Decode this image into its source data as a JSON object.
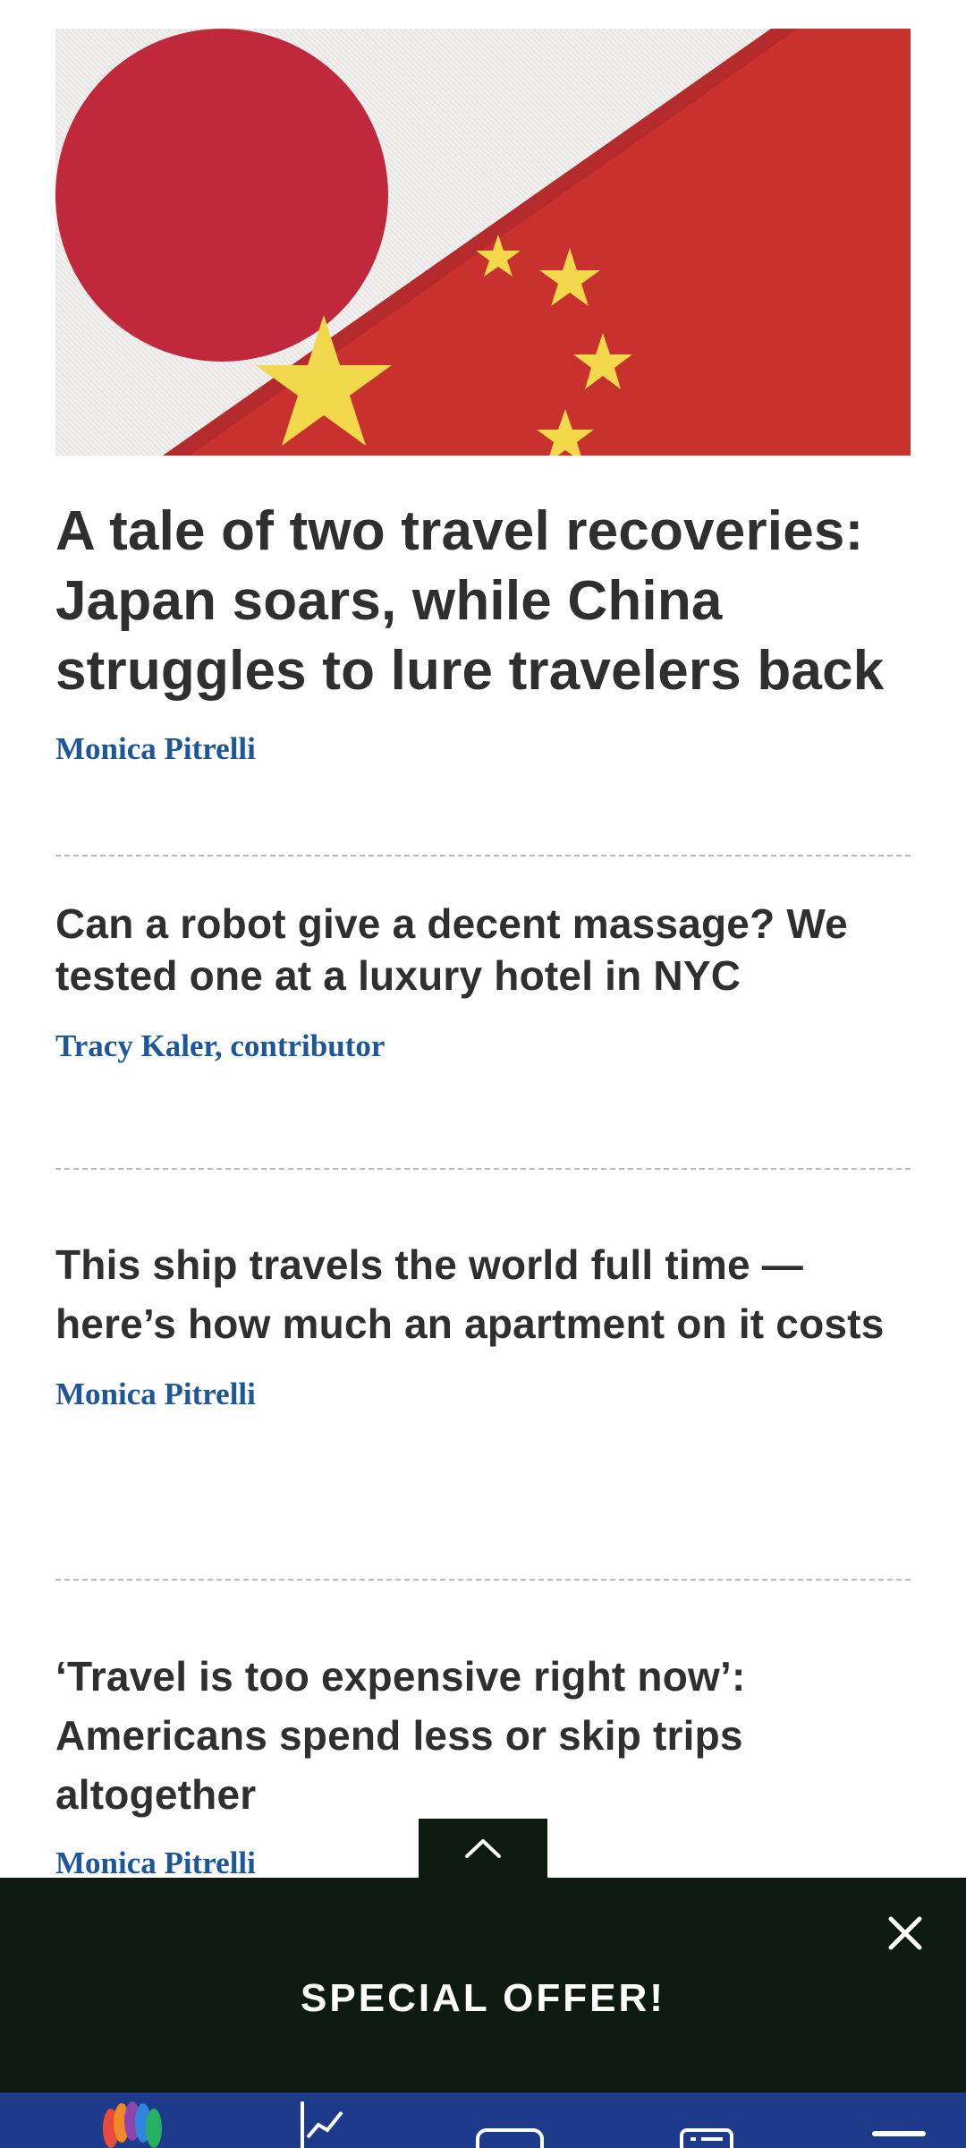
{
  "hero": {
    "image_alt": "Japanese and Chinese flags side by side"
  },
  "articles": [
    {
      "title": "A tale of two travel recoveries: Japan soars, while China struggles to lure travelers back",
      "author": "Monica Pitrelli"
    },
    {
      "title": "Can a robot give a decent massage? We tested one at a luxury hotel in NYC",
      "author": "Tracy Kaler, contributor"
    },
    {
      "title": "This ship travels the world full time — here’s how much an apartment on it costs",
      "author": "Monica Pitrelli"
    },
    {
      "title": "‘Travel is too expensive right now’: Americans spend less or skip trips altogether",
      "author": "Monica Pitrelli"
    }
  ],
  "banner": {
    "title": "SPECIAL OFFER!"
  },
  "colors": {
    "accent_link": "#1e5799",
    "banner_bg": "#0c1a12",
    "nav_bg": "#1e3a8a"
  },
  "icons": {
    "scroll_top": "chevron-up-icon",
    "close": "close-icon",
    "nav": [
      "nbc-peacock-icon",
      "markets-chart-icon",
      "video-icon",
      "watchlist-icon",
      "menu-icon"
    ]
  }
}
